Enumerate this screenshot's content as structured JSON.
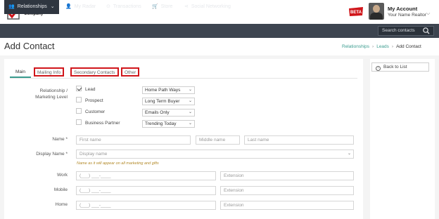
{
  "brand": {
    "logo_text": "Your\nReal Estate\nCompany",
    "beta_label": "BETA"
  },
  "account": {
    "title": "My Account",
    "subtitle": "Your Name Realtor"
  },
  "nav": {
    "items": [
      {
        "label": "Relationships",
        "icon": "people-icon"
      },
      {
        "label": "My Radar",
        "icon": "person-icon"
      },
      {
        "label": "Transactions",
        "icon": "transactions-icon"
      },
      {
        "label": "Store",
        "icon": "cart-icon"
      },
      {
        "label": "Social Networking",
        "icon": "share-icon"
      }
    ],
    "search_label": "Search contacts"
  },
  "page": {
    "title": "Add Contact"
  },
  "breadcrumb": {
    "items": [
      "Relationships",
      "Leads"
    ],
    "current": "Add Contact"
  },
  "sidebar": {
    "back_label": "Back to List"
  },
  "tabs": [
    {
      "label": "Main",
      "active": true
    },
    {
      "label": "Mailing Info",
      "highlighted": true
    },
    {
      "label": "Secondary Contacts",
      "highlighted": true
    },
    {
      "label": "Other",
      "highlighted": true
    }
  ],
  "form": {
    "relationship": {
      "label_line1": "Relationship /",
      "label_line2": "Marketing Level",
      "options": [
        {
          "label": "Lead",
          "checked": true,
          "select_value": "Home Path Ways"
        },
        {
          "label": "Prospect",
          "checked": false,
          "select_value": "Long Term Buyer"
        },
        {
          "label": "Customer",
          "checked": false,
          "select_value": "Emails Only"
        },
        {
          "label": "Business Partner",
          "checked": false,
          "select_value": "Trending Today"
        }
      ]
    },
    "name": {
      "label": "Name *",
      "first_placeholder": "First name",
      "middle_placeholder": "Middle name",
      "last_placeholder": "Last name"
    },
    "display_name": {
      "label": "Display Name *",
      "placeholder": "Display name",
      "hint": "Name as it will appear on all marketing and gifts"
    },
    "phones": [
      {
        "label": "Work",
        "placeholder": "(___) ___-____",
        "ext_placeholder": "Extension"
      },
      {
        "label": "Mobile",
        "placeholder": "(___) ___-____",
        "ext_placeholder": "Extension"
      },
      {
        "label": "Home",
        "placeholder": "(___) ___-____",
        "ext_placeholder": "Extension"
      }
    ]
  },
  "colors": {
    "accent": "#3b9c8f",
    "nav_bg": "#3d4550",
    "highlight_border": "#d0161b"
  }
}
